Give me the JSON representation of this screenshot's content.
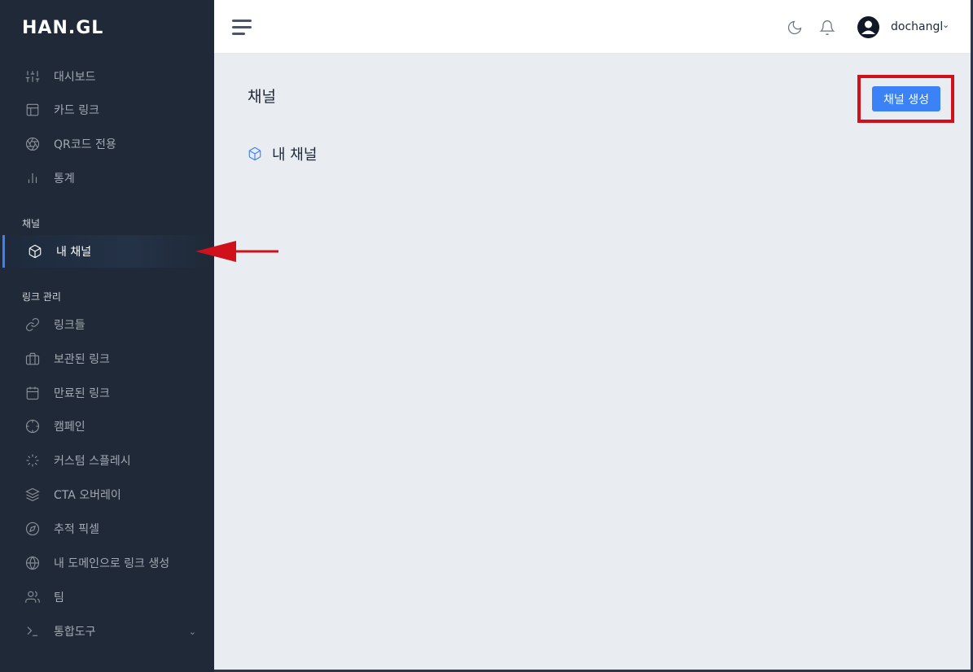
{
  "brand": {
    "logo": "HAN.GL"
  },
  "sidebar": {
    "top_items": [
      {
        "label": "대시보드",
        "icon": "sliders-icon"
      },
      {
        "label": "카드 링크",
        "icon": "layout-icon"
      },
      {
        "label": "QR코드 전용",
        "icon": "aperture-icon"
      },
      {
        "label": "통계",
        "icon": "bar-chart-icon"
      }
    ],
    "section_channel": "채널",
    "channel_items": [
      {
        "label": "내 채널",
        "icon": "box-icon",
        "active": true
      }
    ],
    "section_links": "링크 관리",
    "link_items": [
      {
        "label": "링크들",
        "icon": "link-icon"
      },
      {
        "label": "보관된 링크",
        "icon": "briefcase-icon"
      },
      {
        "label": "만료된 링크",
        "icon": "calendar-icon"
      },
      {
        "label": "캠페인",
        "icon": "crosshair-icon"
      },
      {
        "label": "커스텀 스플레시",
        "icon": "loader-icon"
      },
      {
        "label": "CTA 오버레이",
        "icon": "layers-icon"
      },
      {
        "label": "추적 픽셀",
        "icon": "compass-icon"
      },
      {
        "label": "내 도메인으로 링크 생성",
        "icon": "globe-icon"
      },
      {
        "label": "팀",
        "icon": "users-icon"
      },
      {
        "label": "통합도구",
        "icon": "terminal-icon"
      }
    ]
  },
  "header": {
    "username": "dochangl",
    "icons": [
      "moon-icon",
      "bell-icon",
      "user-avatar-icon"
    ]
  },
  "main": {
    "title": "채널",
    "create_button": "채널 생성",
    "my_channel": "내 채널"
  },
  "colors": {
    "sidebar_bg": "#1f2937",
    "accent": "#3b82f6",
    "highlight": "#d0111b",
    "main_bg": "#e9ecf0"
  }
}
